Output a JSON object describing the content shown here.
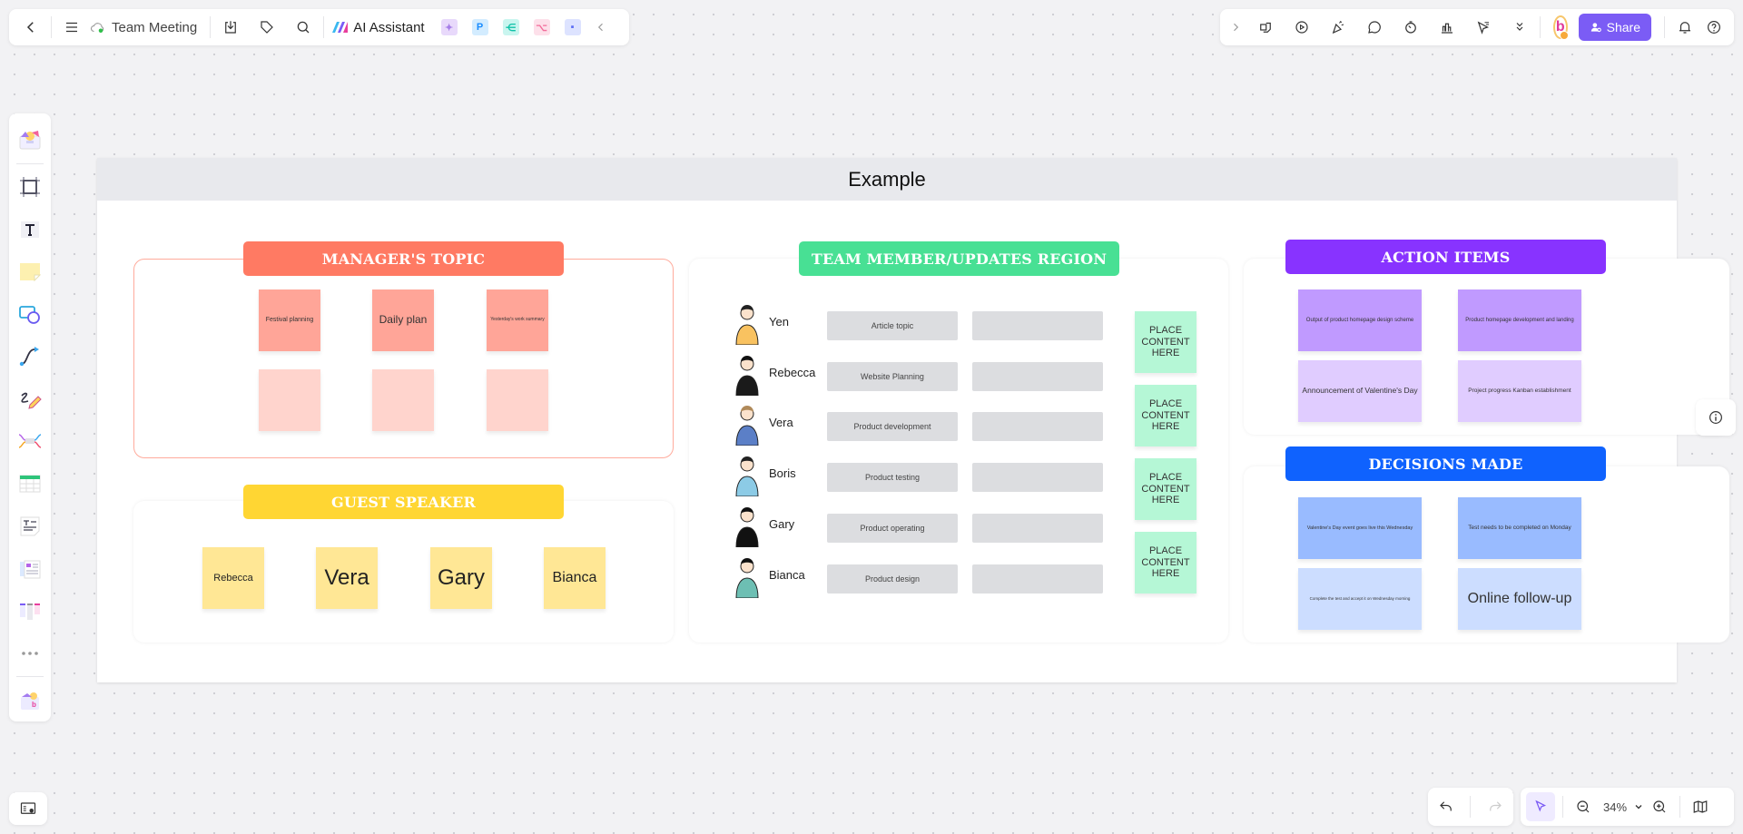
{
  "toolbar_left": {
    "back_icon": "chevron-left",
    "menu_icon": "hamburger",
    "sync_icon": "cloud-synced",
    "document_title": "Team Meeting",
    "download_icon": "download",
    "tag_icon": "tag",
    "search_icon": "search",
    "ai_assistant_label": "AI Assistant",
    "apps": [
      "image-generator",
      "presentation-p",
      "mindmap",
      "flowchart",
      "chat-bubble"
    ],
    "collapse_icon": "chevron-left"
  },
  "toolbar_right": {
    "expand_icon": "chevron-right",
    "tools": [
      "sticky-lock",
      "present-play",
      "celebrate-party",
      "comment",
      "timer",
      "chart-vote",
      "laser-pointer",
      "more-double-chevron"
    ],
    "share_label": "Share",
    "user_avatar_letter": "b",
    "notification_icon": "bell",
    "help_icon": "question"
  },
  "sidebar": {
    "items": [
      "templates",
      "frame",
      "text",
      "sticky-note",
      "shapes",
      "connector",
      "pen",
      "mindmap",
      "table",
      "text-document",
      "cards",
      "kanban",
      "more",
      "plugins"
    ]
  },
  "board": {
    "title": "Example",
    "managers_topic": {
      "title": "MANAGER'S TOPIC",
      "color": "#ff7a63",
      "notes": [
        "Festival planning",
        "Daily plan",
        "Yesterday's work summary",
        "",
        "",
        ""
      ]
    },
    "guest_speaker": {
      "title": "GUEST SPEAKER",
      "color": "#ffd633",
      "notes": [
        "Rebecca",
        "Vera",
        "Gary",
        "Bianca"
      ]
    },
    "team_updates": {
      "title": "TEAM MEMBER/UPDATES REGION",
      "color": "#48e094",
      "rows": [
        {
          "name": "Yen",
          "topic": "Article topic",
          "update": ""
        },
        {
          "name": "Rebecca",
          "topic": "Website Planning",
          "update": ""
        },
        {
          "name": "Vera",
          "topic": "Product development",
          "update": ""
        },
        {
          "name": "Boris",
          "topic": "Product testing",
          "update": ""
        },
        {
          "name": "Gary",
          "topic": "Product operating",
          "update": ""
        },
        {
          "name": "Bianca",
          "topic": "Product design",
          "update": ""
        }
      ],
      "placeholders": [
        "PLACE CONTENT HERE",
        "PLACE CONTENT HERE",
        "PLACE CONTENT HERE",
        "PLACE CONTENT HERE"
      ]
    },
    "action_items": {
      "title": "ACTION ITEMS",
      "color": "#8833ff",
      "notes": [
        "Output of product homepage design scheme",
        "Product homepage development and landing",
        "Announcement of Valentine's Day",
        "Project progress Kanban establishment"
      ]
    },
    "decisions_made": {
      "title": "DECISIONS MADE",
      "color": "#0f62fe",
      "notes": [
        "Valentine's Day event goes live this Wednesday",
        "Test needs to be completed on Monday",
        "Complete the test and accept it on Wednesday morning",
        "Online follow-up"
      ]
    }
  },
  "bottom_bar": {
    "zoom_level": "34%",
    "undo_icon": "undo",
    "redo_icon": "redo",
    "select_icon": "cursor-select",
    "zoom_out_icon": "zoom-out",
    "zoom_in_icon": "zoom-in",
    "map_icon": "minimap"
  }
}
